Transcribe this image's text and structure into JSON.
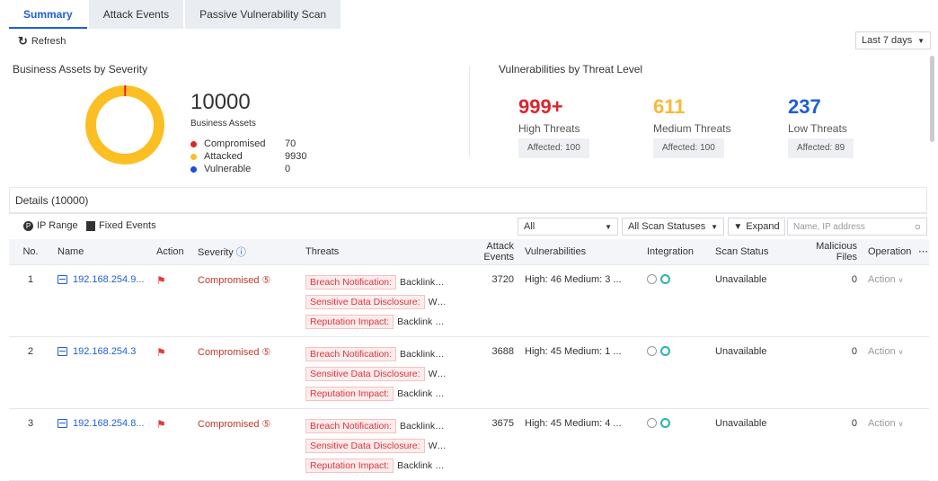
{
  "tabs": [
    {
      "label": "Summary"
    },
    {
      "label": "Attack Events"
    },
    {
      "label": "Passive Vulnerability Scan"
    }
  ],
  "toolbar": {
    "refresh_label": "Refresh",
    "range": "Last 7 days"
  },
  "assets": {
    "title": "Business Assets by Severity",
    "total": "10000",
    "total_label": "Business Assets",
    "legend": [
      {
        "label": "Compromised",
        "value": "70",
        "color": "#e02424"
      },
      {
        "label": "Attacked",
        "value": "9930",
        "color": "#fbbf24"
      },
      {
        "label": "Vulnerable",
        "value": "0",
        "color": "#1d4ed8"
      }
    ]
  },
  "vulns": {
    "title": "Vulnerabilities by Threat Level",
    "levels": [
      {
        "num": "999+",
        "label": "High Threats",
        "affected": "Affected: 100",
        "color": "#d9262e"
      },
      {
        "num": "611",
        "label": "Medium Threats",
        "affected": "Affected: 100",
        "color": "#f6b93b"
      },
      {
        "num": "237",
        "label": "Low Threats",
        "affected": "Affected: 89",
        "color": "#1f5fd6"
      }
    ]
  },
  "details": {
    "title": "Details (10000)",
    "ip_range": "IP Range",
    "fixed_events": "Fixed Events",
    "filter_all": "All",
    "filter_scan": "All Scan Statuses",
    "expand": "Expand",
    "search_placeholder": "Name, IP address"
  },
  "columns": [
    "No.",
    "Name",
    "Action",
    "Severity",
    "Threats",
    "Attack Events",
    "Vulnerabilities",
    "Integration",
    "Scan Status",
    "Malicious Files",
    "Operation",
    "⋯"
  ],
  "rows": [
    {
      "no": "1",
      "name": "192.168.254.9...",
      "severity": "Compromised",
      "threats": [
        {
          "tag": "Breach Notification:",
          "text": "Backlink Inje..."
        },
        {
          "tag": "Sensitive Data Disclosure:",
          "text": "WebS..."
        },
        {
          "tag": "Reputation Impact:",
          "text": "Backlink Injec..."
        }
      ],
      "attack_events": "3720",
      "vulns": "High: 46   Medium: 3   ...",
      "scan_status": "Unavailable",
      "malicious": "0",
      "operation": "Action"
    },
    {
      "no": "2",
      "name": "192.168.254.3",
      "severity": "Compromised",
      "threats": [
        {
          "tag": "Breach Notification:",
          "text": "Backlink Inje..."
        },
        {
          "tag": "Sensitive Data Disclosure:",
          "text": "WebS..."
        },
        {
          "tag": "Reputation Impact:",
          "text": "Backlink Injec..."
        }
      ],
      "attack_events": "3688",
      "vulns": "High: 45   Medium: 1   ...",
      "scan_status": "Unavailable",
      "malicious": "0",
      "operation": "Action"
    },
    {
      "no": "3",
      "name": "192.168.254.8...",
      "severity": "Compromised",
      "threats": [
        {
          "tag": "Breach Notification:",
          "text": "Backlink Inje..."
        },
        {
          "tag": "Sensitive Data Disclosure:",
          "text": "WebS..."
        },
        {
          "tag": "Reputation Impact:",
          "text": "Backlink Injec..."
        }
      ],
      "attack_events": "3675",
      "vulns": "High: 45   Medium: 4   ...",
      "scan_status": "Unavailable",
      "malicious": "0",
      "operation": "Action"
    }
  ]
}
